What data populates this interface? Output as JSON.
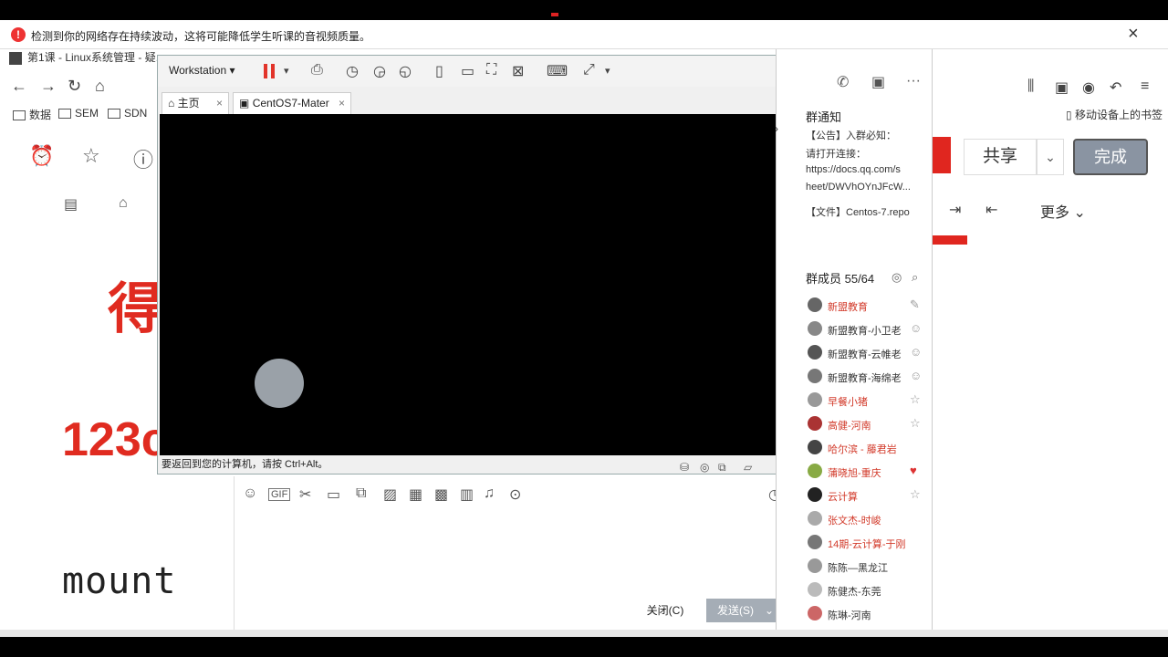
{
  "notice": {
    "icon": "warning-icon",
    "message": "检测到你的网络存在持续波动，这将可能降低学生听课的音视频质量。",
    "close": "×"
  },
  "browser": {
    "tab_title": "第1课 - Linux系统管理 - 疑...",
    "bookmarks": [
      "数据",
      "SEM",
      "SDN"
    ],
    "mobile_bookmarks": "移动设备上的书签"
  },
  "page": {
    "big_red_text": "得",
    "big_number": "123c",
    "mount_text": "mount",
    "share_button": "共享",
    "done_button": "完成",
    "more_label": "更多"
  },
  "vmware": {
    "workstation_label": "Workstation",
    "tabs": [
      {
        "label": "主页",
        "icon": "home-icon"
      },
      {
        "label": "CentOS7-Mater",
        "icon": "vm-icon"
      }
    ],
    "status_text": "要返回到您的计算机，请按 Ctrl+Alt。"
  },
  "chat": {
    "close_button": "关闭(C)",
    "send_button": "发送(S)"
  },
  "group": {
    "notice_title": "群通知",
    "notice_lines": [
      "【公告】入群必知：",
      "请打开连接：",
      "https://docs.qq.com/s",
      "heet/DWVhOYnJFcW...",
      "【文件】Centos-7.repo"
    ],
    "members_title": "群成员 55/64",
    "members": [
      {
        "name": "新盟教育",
        "red": true,
        "badge": "✎"
      },
      {
        "name": "新盟教育-小卫老",
        "red": false,
        "badge": "☺"
      },
      {
        "name": "新盟教育-云帷老",
        "red": false,
        "badge": "☺"
      },
      {
        "name": "新盟教育-海绵老",
        "red": false,
        "badge": "☺"
      },
      {
        "name": "早餐小猪",
        "red": true,
        "badge": "☆"
      },
      {
        "name": "高健-河南",
        "red": true,
        "badge": "☆"
      },
      {
        "name": "哈尔滨 - 藤君岩",
        "red": true,
        "badge": ""
      },
      {
        "name": "蒲晓旭-重庆",
        "red": true,
        "badge": "♥"
      },
      {
        "name": "云计算",
        "red": true,
        "badge": "☆"
      },
      {
        "name": "张文杰-时峻",
        "red": true,
        "badge": ""
      },
      {
        "name": "14期-云计算-于刚",
        "red": true,
        "badge": ""
      },
      {
        "name": "陈陈—黑龙江",
        "red": false,
        "badge": ""
      },
      {
        "name": "陈健杰-东莞",
        "red": false,
        "badge": ""
      },
      {
        "name": "陈琳-河南",
        "red": false,
        "badge": ""
      }
    ]
  },
  "colors": {
    "accent_red": "#e02b20",
    "send_button": "#a5adb6"
  }
}
